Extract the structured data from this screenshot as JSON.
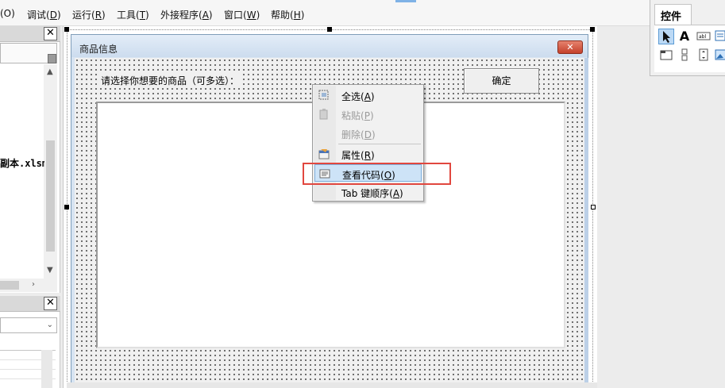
{
  "menu": {
    "items": [
      {
        "label": "(O)"
      },
      {
        "label": "调试(",
        "key": "D",
        "suffix": ")"
      },
      {
        "label": "运行(",
        "key": "R",
        "suffix": ")"
      },
      {
        "label": "工具(",
        "key": "T",
        "suffix": ")"
      },
      {
        "label": "外接程序(",
        "key": "A",
        "suffix": ")"
      },
      {
        "label": "窗口(",
        "key": "W",
        "suffix": ")"
      },
      {
        "label": "帮助(",
        "key": "H",
        "suffix": ")"
      }
    ]
  },
  "project_panel": {
    "close_glyph": "✕",
    "file_label": "副本.xlsm"
  },
  "properties_panel": {
    "close_glyph": "✕"
  },
  "form": {
    "title": "商品信息",
    "close_glyph": "✕",
    "label_text": "请选择你想要的商品（可多选）：",
    "ok_button": "确定"
  },
  "context_menu": {
    "items": [
      {
        "label": "全选(",
        "key": "A",
        "suffix": ")",
        "enabled": true,
        "icon": "select-all-icon"
      },
      {
        "label": "粘贴(",
        "key": "P",
        "suffix": ")",
        "enabled": false,
        "icon": "paste-icon"
      },
      {
        "label": "删除(",
        "key": "D",
        "suffix": ")",
        "enabled": false,
        "icon": "delete-icon"
      },
      {
        "label": "属性(",
        "key": "R",
        "suffix": ")",
        "enabled": true,
        "icon": "properties-icon"
      },
      {
        "label": "查看代码(",
        "key": "O",
        "suffix": ")",
        "enabled": true,
        "icon": "view-code-icon",
        "highlighted": true
      },
      {
        "label": "Tab 键顺序(",
        "key": "A",
        "suffix": ")",
        "enabled": true,
        "icon": ""
      }
    ],
    "annotation_color": "#e1473f"
  },
  "toolbox": {
    "tab_label": "控件",
    "tools_row1": [
      "pointer-icon",
      "label-tool-icon",
      "textbox-tool-icon",
      "combobox-tool-icon"
    ],
    "tools_row2": [
      "frame-tool-icon",
      "spinbutton-tool-icon",
      "scrollbar-tool-icon",
      "image-tool-icon"
    ]
  }
}
